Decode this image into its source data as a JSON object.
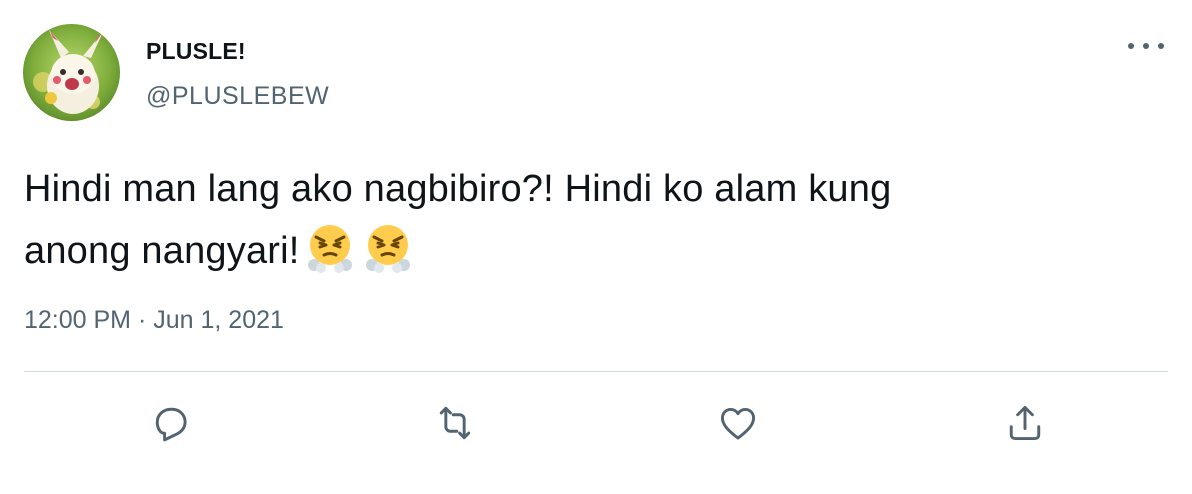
{
  "tweet": {
    "display_name": "PLUSLE!",
    "handle": "@PLUSLEBEW",
    "text_line1": "Hindi man lang ako nagbibiro?! Hindi ko alam kung",
    "text_line2": "anong nangyari!",
    "emojis": [
      "face-with-steam-from-nose",
      "face-with-steam-from-nose"
    ],
    "time": "12:00 PM",
    "separator": "·",
    "date": "Jun 1, 2021"
  },
  "icons": {
    "more": "more-horizontal-icon",
    "reply": "reply-icon",
    "retweet": "retweet-icon",
    "like": "heart-icon",
    "share": "share-icon"
  },
  "colors": {
    "text": "#0f1419",
    "secondary": "#536471",
    "divider": "#cfd9de",
    "emoji": "#ffcc4d"
  }
}
